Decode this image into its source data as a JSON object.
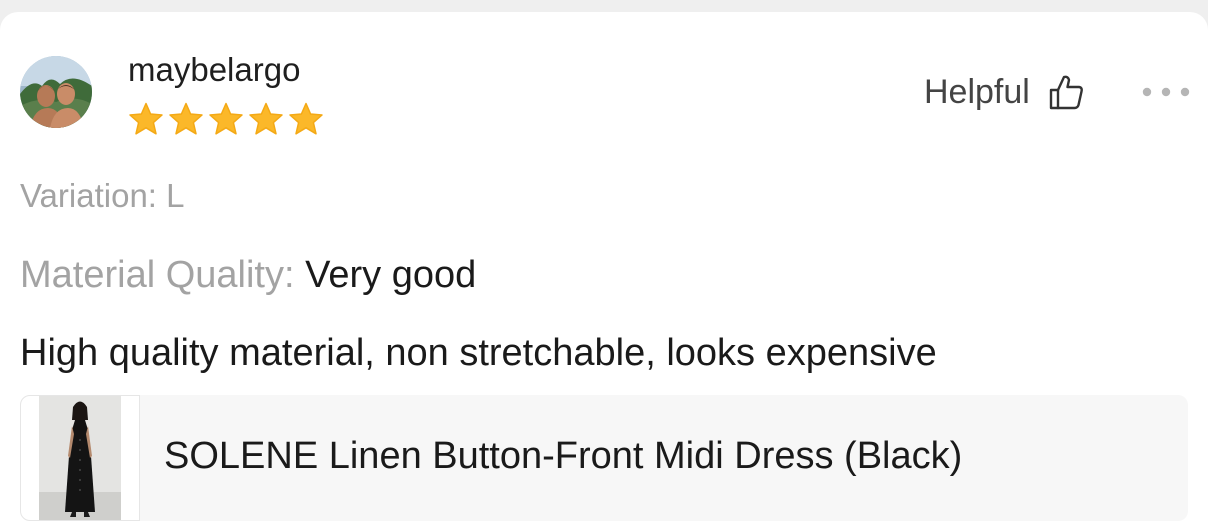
{
  "review": {
    "username": "maybelargo",
    "rating": 5,
    "rating_max": 5,
    "variation": "Variation: L",
    "attribute_label": "Material Quality:",
    "attribute_value": "Very good",
    "text": "High quality material, non stretchable, looks expensive"
  },
  "actions": {
    "helpful_label": "Helpful"
  },
  "product": {
    "name": "SOLENE Linen Button-Front Midi Dress (Black)"
  },
  "colors": {
    "star": "#fbb829",
    "muted_text": "#a3a3a3",
    "primary_text": "#1a1a1a"
  },
  "icons": {
    "avatar": "avatar-photo",
    "rating": "star-icon",
    "helpful": "thumbs-up-icon",
    "more": "more-horizontal-icon",
    "product": "product-thumbnail"
  }
}
